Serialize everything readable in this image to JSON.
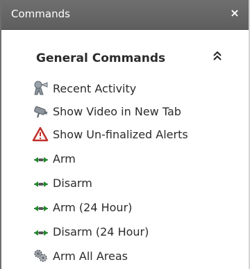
{
  "window": {
    "title": "Commands",
    "close_glyph": "×"
  },
  "group": {
    "title": "General Commands",
    "collapse_icon": "double-chevron-up-icon",
    "items": [
      {
        "label": "Recent Activity",
        "icon": "activity-figure-icon"
      },
      {
        "label": "Show Video in New Tab",
        "icon": "camera-icon"
      },
      {
        "label": "Show Un-finalized Alerts",
        "icon": "alert-triangle-icon"
      },
      {
        "label": "Arm",
        "icon": "arm-arrows-icon"
      },
      {
        "label": "Disarm",
        "icon": "arm-arrows-icon"
      },
      {
        "label": "Arm (24 Hour)",
        "icon": "arm-arrows-icon"
      },
      {
        "label": "Disarm (24 Hour)",
        "icon": "arm-arrows-icon"
      },
      {
        "label": "Arm All Areas",
        "icon": "gear-cluster-icon"
      }
    ]
  },
  "colors": {
    "titlebar": "#666666",
    "alert": "#c0302b",
    "arm_arrow": "#1e8a2a"
  }
}
